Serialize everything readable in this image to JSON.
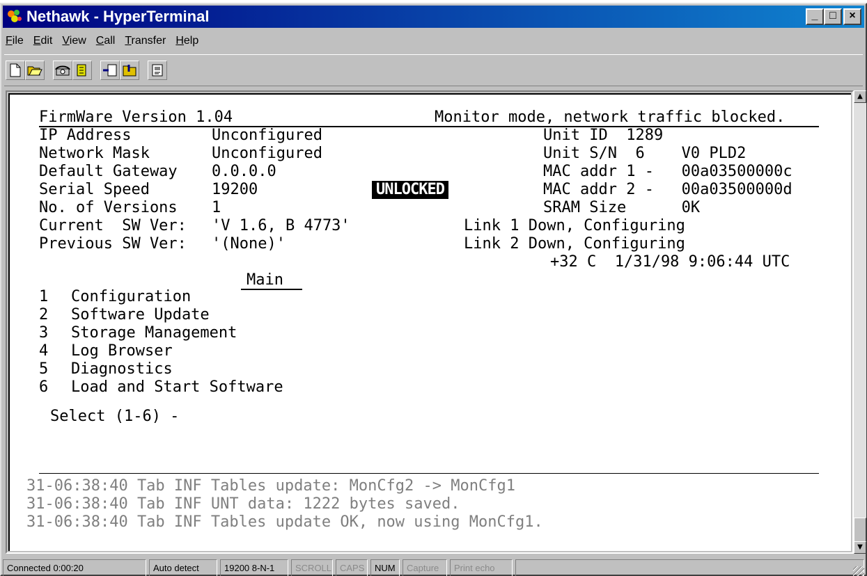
{
  "window": {
    "title": "Nethawk - HyperTerminal",
    "minimize": "_",
    "maximize": "□",
    "close": "×"
  },
  "menu": [
    "File",
    "Edit",
    "View",
    "Call",
    "Transfer",
    "Help"
  ],
  "toolbar": {
    "icons": [
      "new-icon",
      "open-icon",
      "dial-icon",
      "disconnect-icon",
      "send-icon",
      "receive-icon",
      "properties-icon"
    ]
  },
  "terminal": {
    "header_left": "FirmWare Version 1.04",
    "header_right": "Monitor mode, network traffic blocked.",
    "info_rows": [
      {
        "label": "IP Address",
        "value": "Unconfigured"
      },
      {
        "label": "Network Mask",
        "value": "Unconfigured"
      },
      {
        "label": "Default Gateway",
        "value": "0.0.0.0"
      },
      {
        "label": "Serial Speed",
        "value": "19200"
      },
      {
        "label": "No. of Versions",
        "value": "1"
      },
      {
        "label": "Current  SW Ver:",
        "value": "'V 1.6, B 4773'"
      },
      {
        "label": "Previous SW Ver:",
        "value": "'(None)'"
      }
    ],
    "lock_status": "UNLOCKED",
    "unit_rows": [
      "Unit ID  1289",
      "Unit S/N  6    V0 PLD2",
      "MAC addr 1 -   00a03500000c",
      "MAC addr 2 -   00a03500000d",
      "SRAM Size      0K"
    ],
    "link1": "Link 1 Down, Configuring",
    "link2": "Link 2 Down, Configuring",
    "temp_time": "+32 C  1/31/98 9:06:44 UTC",
    "menu_title": "Main",
    "menu_items": [
      {
        "num": "1",
        "label": "Configuration"
      },
      {
        "num": "2",
        "label": "Software Update"
      },
      {
        "num": "3",
        "label": "Storage Management"
      },
      {
        "num": "4",
        "label": "Log Browser"
      },
      {
        "num": "5",
        "label": "Diagnostics"
      },
      {
        "num": "6",
        "label": "Load and Start Software"
      }
    ],
    "prompt": "Select (1-6) -",
    "log": [
      "31-06:38:40 Tab INF Tables update: MonCfg2 -> MonCfg1",
      "31-06:38:40 Tab INF UNT data: 1222 bytes saved.",
      "31-06:38:40 Tab INF Tables update OK, now using MonCfg1."
    ]
  },
  "status": {
    "connected": "Connected 0:00:20",
    "detect": "Auto detect",
    "port": "19200 8-N-1",
    "scroll": "SCROLL",
    "caps": "CAPS",
    "num": "NUM",
    "capture": "Capture",
    "print_echo": "Print echo"
  }
}
